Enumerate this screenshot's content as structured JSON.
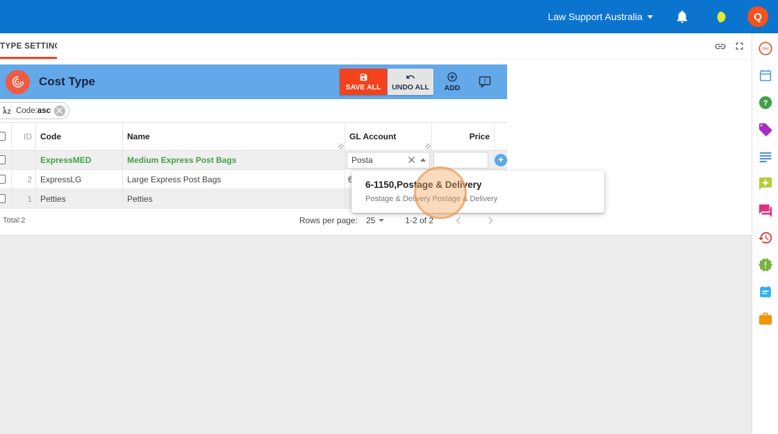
{
  "topbar": {
    "org": "Law Support Australia",
    "avatar": "Q"
  },
  "tabbar": {
    "active_tab": "TYPE SETTING"
  },
  "panel": {
    "title": "Cost Type",
    "save": "SAVE ALL",
    "undo": "UNDO ALL",
    "add": "ADD"
  },
  "filter_chip": {
    "label": "Code:",
    "value": "asc"
  },
  "table": {
    "columns": {
      "id": "ID",
      "code": "Code",
      "name": "Name",
      "gl": "GL Account",
      "price": "Price"
    },
    "rows": [
      {
        "id": "",
        "code": "ExpressMED",
        "name": "Medium Express Post Bags",
        "gl_input": "Posta",
        "price": ""
      },
      {
        "id": "2",
        "code": "ExpressLG",
        "name": "Large Express Post Bags",
        "gl_visible": "6",
        "price": ""
      },
      {
        "id": "1",
        "code": "Petties",
        "name": "Petties",
        "gl_visible": "",
        "price": ""
      }
    ]
  },
  "dropdown": {
    "title": "6-1150,Postage & Delivery",
    "subtitle": "Postage & Delivery Postage & Delivery"
  },
  "footer": {
    "total": "Total:2",
    "rows_per_page": "Rows per page:",
    "page_size": "25",
    "range": "1-2 of 2"
  },
  "sidebar": {
    "progress": "0%",
    "icons": [
      "progress-circle",
      "calendar",
      "help",
      "tag",
      "text-lines",
      "announcement",
      "chat",
      "history",
      "alert",
      "notes",
      "briefcase"
    ]
  },
  "colors": {
    "topbar": "#0b74cf",
    "panel_header": "#63a8e9",
    "save_red": "#f4421c",
    "row_green": "#43a047",
    "avatar_orange": "#f4511e"
  }
}
